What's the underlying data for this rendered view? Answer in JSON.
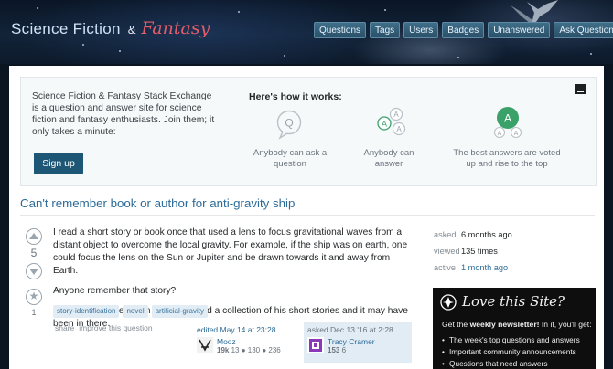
{
  "header": {
    "logo_part1": "Science Fiction",
    "logo_amp": "&",
    "logo_part2": "Fantasy",
    "nav": [
      "Questions",
      "Tags",
      "Users",
      "Badges",
      "Unanswered",
      "Ask Question"
    ]
  },
  "welcome": {
    "text": "Science Fiction & Fantasy Stack Exchange is a question and answer site for science fiction and fantasy enthusiasts. Join them; it only takes a minute:",
    "signup_label": "Sign up",
    "how_title": "Here's how it works:",
    "steps": [
      {
        "caption": "Anybody can ask a question",
        "icon": "question-bubble-icon"
      },
      {
        "caption": "Anybody can answer",
        "icon": "answer-bubbles-icon"
      },
      {
        "caption": "The best answers are voted up and rise to the top",
        "icon": "best-answer-icon"
      }
    ]
  },
  "question": {
    "title": "Can't remember book or author for anti-gravity ship",
    "votes": "5",
    "favorites": "1",
    "body": [
      "I read a short story or book once that used a lens to focus gravitational waves from a distant object to overcome the local gravity. For example, if the ship was on earth, one could focus the lens on the Sun or Jupiter and be drawn towards it and away from Earth.",
      "Anyone remember that story?",
      "It could have been from Asimov - I had a collection of his short stories and it may have been in there."
    ],
    "tags": [
      "story-identification",
      "novel",
      "artificial-gravity"
    ],
    "menu": [
      "share",
      "improve this question"
    ],
    "editor": {
      "action": "edited May 14 at 23:28",
      "name": "Mooz",
      "rep": "19k",
      "badges": "13 ● 130 ● 236"
    },
    "owner": {
      "action": "asked Dec 13 '16 at 2:28",
      "name": "Tracy Cramer",
      "rep": "153",
      "badges": "6"
    }
  },
  "meta": {
    "asked_label": "asked",
    "asked_value": "6 months ago",
    "viewed_label": "viewed",
    "viewed_value": "135 times",
    "active_label": "active",
    "active_value": "1 month ago"
  },
  "promo": {
    "title": "Love this Site?",
    "text_prefix": "Get the ",
    "text_bold": "weekly newsletter!",
    "text_suffix": " In it, you'll get:",
    "items": [
      "The week's top questions and answers",
      "Important community announcements",
      "Questions that need answers"
    ]
  },
  "colors": {
    "link": "#2b6b96",
    "signup_bg": "#1d5775",
    "accent_green": "#3aa168",
    "logo_red": "#e35d6a",
    "tag_bg": "#e1ecf4"
  }
}
